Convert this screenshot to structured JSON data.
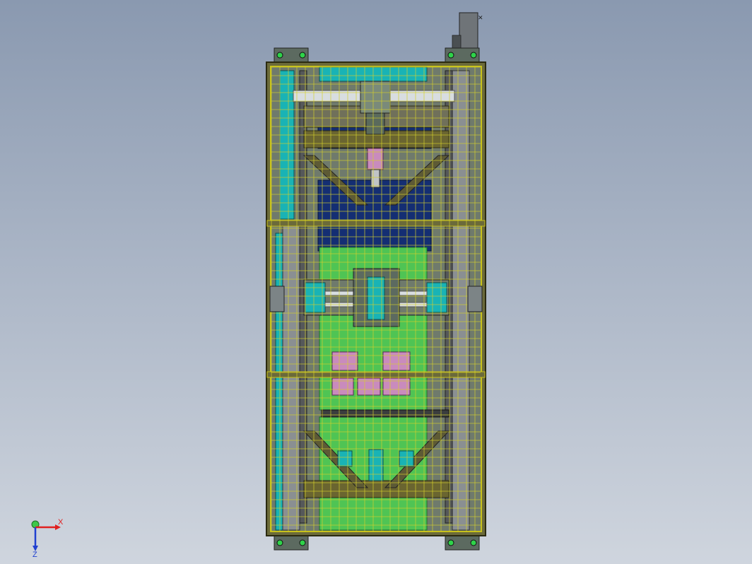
{
  "view": {
    "type": "cad-top-view",
    "colors": {
      "background_top": "#8a99b0",
      "background_bottom": "#cfd5de",
      "frame_outer": "#5f5a2b",
      "frame_yellow": "#c8c21a",
      "mesh_grid": "#d6d12b",
      "steel_gray": "#8a8f92",
      "dark_steel": "#55585a",
      "cyan_panel": "#19b3b5",
      "navy_block": "#142e73",
      "green_plate": "#4fc454",
      "pink_part": "#c98bbd",
      "silver_shaft": "#d8dde0"
    }
  },
  "triad": {
    "x_label": "X",
    "z_label": "Z",
    "icons": [
      "axis-x-icon",
      "axis-y-icon",
      "axis-z-icon"
    ]
  }
}
